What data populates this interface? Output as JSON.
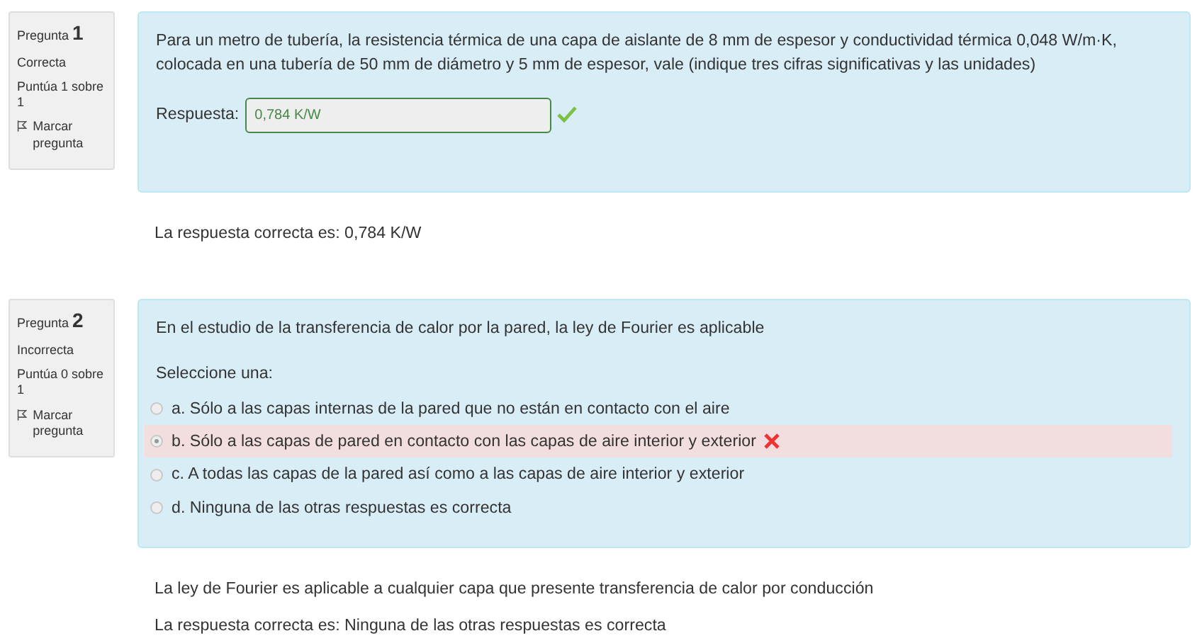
{
  "questions": [
    {
      "kind": "short",
      "label": "Pregunta",
      "number": "1",
      "state": "Correcta",
      "grade": "Puntúa 1 sobre 1",
      "flag": "Marcar pregunta",
      "correct": true,
      "text": "Para un metro de tubería, la resistencia térmica de una capa de aislante de 8 mm de espesor y conductividad térmica 0,048 W/m·K, colocada en una tubería de 50 mm de diámetro y 5 mm de espesor, vale (indique tres cifras significativas y las unidades)",
      "answer_label": "Respuesta:",
      "answer_value": "0,784 K/W",
      "feedback": [
        "La respuesta correcta es: 0,784 K/W"
      ]
    },
    {
      "kind": "choice",
      "label": "Pregunta",
      "number": "2",
      "state": "Incorrecta",
      "grade": "Puntúa 0 sobre 1",
      "flag": "Marcar pregunta",
      "correct": false,
      "text": "En el estudio de la transferencia de calor por la pared, la ley de Fourier es aplicable",
      "prompt": "Seleccione una:",
      "options": [
        {
          "text": "a. Sólo a las capas internas de la pared que no están en contacto con el aire",
          "selected": false
        },
        {
          "text": "b. Sólo a las capas de pared en contacto con las capas de aire interior y exterior",
          "selected": true
        },
        {
          "text": "c. A todas las capas de la pared así como a las capas de aire interior y exterior",
          "selected": false
        },
        {
          "text": "d. Ninguna de las otras respuestas es correcta",
          "selected": false
        }
      ],
      "feedback": [
        "La ley de Fourier es aplicable a cualquier capa que presente transferencia de calor por conducción",
        "La respuesta correcta es: Ninguna de las otras respuestas es correcta"
      ]
    }
  ]
}
